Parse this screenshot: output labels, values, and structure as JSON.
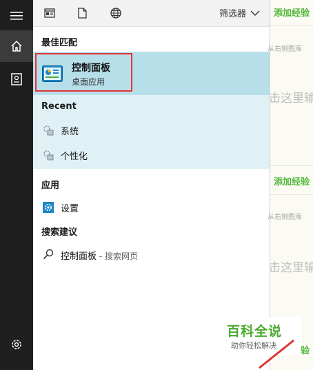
{
  "sidebar": {
    "items": [
      {
        "name": "hamburger-menu-icon"
      },
      {
        "name": "home-icon"
      },
      {
        "name": "notebook-icon"
      },
      {
        "name": "settings-gear-icon"
      }
    ]
  },
  "toolbar": {
    "filter_label": "筛选器"
  },
  "sections": {
    "best_match": "最佳匹配",
    "recent": "Recent",
    "apps": "应用",
    "search_suggestions": "搜索建议"
  },
  "best_match": {
    "title": "控制面板",
    "subtitle": "桌面应用"
  },
  "recent_items": [
    {
      "label": "系统"
    },
    {
      "label": "个性化"
    }
  ],
  "apps_items": [
    {
      "label": "设置"
    }
  ],
  "suggestion": {
    "query": "控制面板",
    "suffix": " - 搜索网页"
  },
  "background_page": {
    "add_experience": "添加经验",
    "pick_image": "从右侧图库",
    "click_here": "击这里输"
  },
  "watermark": {
    "title": "百科全说",
    "subtitle": "助你轻松解决"
  },
  "colors": {
    "rail": "#1f1f1f",
    "best_match_bg": "#b7dfe9",
    "recent_bg": "#e0f1f6",
    "highlight_outline": "#e23434",
    "accent_blue": "#1e88c7",
    "green": "#53b83a"
  }
}
